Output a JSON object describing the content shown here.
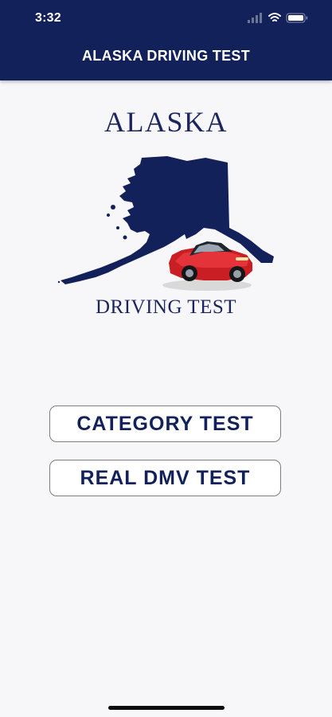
{
  "status_bar": {
    "time": "3:32"
  },
  "header": {
    "title": "ALASKA DRIVING TEST"
  },
  "logo": {
    "title": "ALASKA",
    "subtitle": "DRIVING TEST"
  },
  "buttons": {
    "category_test": "CATEGORY TEST",
    "real_dmv_test": "REAL DMV TEST"
  },
  "colors": {
    "header_bg": "#13215a",
    "map_fill": "#13215a",
    "car_body": "#d8252a",
    "button_text": "#13215a"
  }
}
